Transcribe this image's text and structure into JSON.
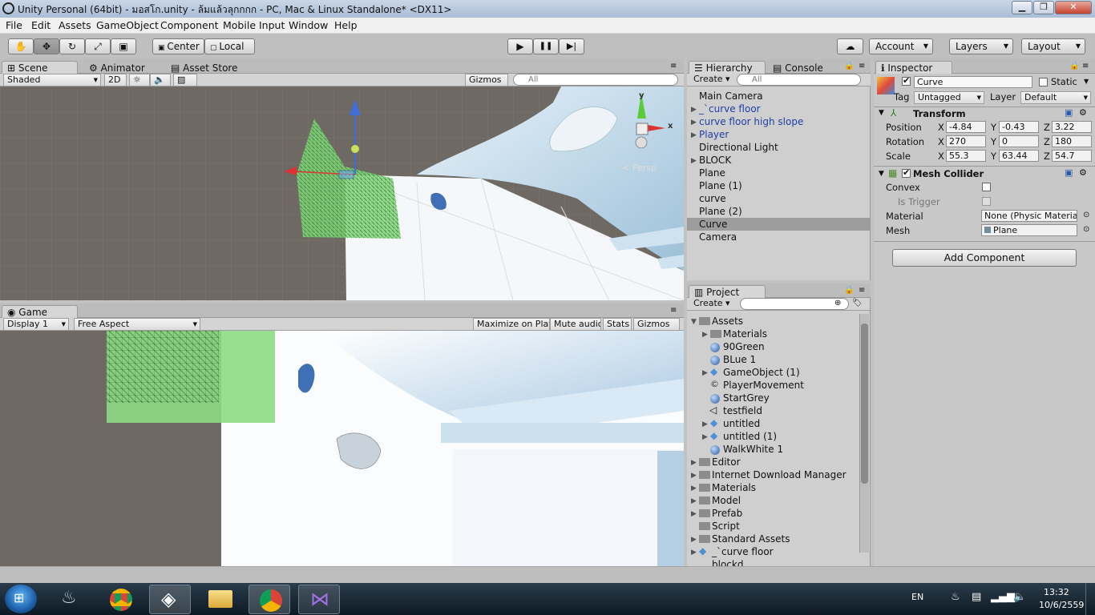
{
  "window": {
    "title": "Unity Personal (64bit) - มอสโก.unity - ล้มแล้วลุกกกก - PC, Mac & Linux Standalone* <DX11>",
    "min_label": "▁",
    "max_label": "❐",
    "close_label": "✕"
  },
  "menu": [
    "File",
    "Edit",
    "Assets",
    "GameObject",
    "Component",
    "Mobile Input",
    "Window",
    "Help"
  ],
  "toolbar": {
    "pivot": "Center",
    "space": "Local",
    "play": "▶",
    "pause": "❚❚",
    "step": "▶|",
    "account": "Account",
    "layers": "Layers",
    "layout": "Layout"
  },
  "scene": {
    "tabs": [
      "Scene",
      "Animator",
      "Asset Store"
    ],
    "shading": "Shaded",
    "mode2d": "2D",
    "gizmos": "Gizmos",
    "search_placeholder": "All",
    "persp": "< Persp"
  },
  "game": {
    "tab": "Game",
    "display": "Display 1",
    "aspect": "Free Aspect",
    "maximize": "Maximize on Play",
    "mute": "Mute audio",
    "stats": "Stats",
    "gizmos": "Gizmos"
  },
  "hierarchy": {
    "tabs": [
      "Hierarchy",
      "Console"
    ],
    "create": "Create",
    "search_placeholder": "All",
    "items": [
      {
        "label": "Main Camera",
        "expandable": false,
        "prefab": false
      },
      {
        "label": "_`curve floor",
        "expandable": true,
        "prefab": true
      },
      {
        "label": "curve floor high slope",
        "expandable": true,
        "prefab": true
      },
      {
        "label": "Player",
        "expandable": true,
        "prefab": true
      },
      {
        "label": "Directional Light",
        "expandable": false,
        "prefab": false
      },
      {
        "label": "BLOCK",
        "expandable": true,
        "prefab": false
      },
      {
        "label": "Plane",
        "expandable": false,
        "prefab": false
      },
      {
        "label": "Plane (1)",
        "expandable": false,
        "prefab": false
      },
      {
        "label": "curve",
        "expandable": false,
        "prefab": false
      },
      {
        "label": "Plane (2)",
        "expandable": false,
        "prefab": false
      },
      {
        "label": "Curve",
        "expandable": false,
        "prefab": false,
        "selected": true
      },
      {
        "label": "Camera",
        "expandable": false,
        "prefab": false
      }
    ]
  },
  "project": {
    "tab": "Project",
    "create": "Create",
    "items": [
      {
        "label": "Assets",
        "indent": 0,
        "kind": "folder",
        "open": true
      },
      {
        "label": "Materials",
        "indent": 1,
        "kind": "folder"
      },
      {
        "label": "90Green",
        "indent": 1,
        "kind": "material"
      },
      {
        "label": "BLue 1",
        "indent": 1,
        "kind": "material"
      },
      {
        "label": "GameObject (1)",
        "indent": 1,
        "kind": "prefab"
      },
      {
        "label": "PlayerMovement",
        "indent": 1,
        "kind": "script"
      },
      {
        "label": "StartGrey",
        "indent": 1,
        "kind": "material"
      },
      {
        "label": "testfield",
        "indent": 1,
        "kind": "scene"
      },
      {
        "label": "untitled",
        "indent": 1,
        "kind": "prefab"
      },
      {
        "label": "untitled (1)",
        "indent": 1,
        "kind": "prefab"
      },
      {
        "label": "WalkWhite 1",
        "indent": 1,
        "kind": "material"
      },
      {
        "label": "Editor",
        "indent": 0,
        "kind": "folder"
      },
      {
        "label": "Internet Download Manager",
        "indent": 0,
        "kind": "folder"
      },
      {
        "label": "Materials",
        "indent": 0,
        "kind": "folder"
      },
      {
        "label": "Model",
        "indent": 0,
        "kind": "folder"
      },
      {
        "label": "Prefab",
        "indent": 0,
        "kind": "folder"
      },
      {
        "label": "Script",
        "indent": 0,
        "kind": "folder"
      },
      {
        "label": "Standard Assets",
        "indent": 0,
        "kind": "folder"
      },
      {
        "label": "_`curve floor",
        "indent": 0,
        "kind": "prefab"
      },
      {
        "label": "blockd",
        "indent": 0,
        "kind": "prefab"
      }
    ]
  },
  "inspector": {
    "tab": "Inspector",
    "object_name": "Curve",
    "static_label": "Static",
    "tag_label": "Tag",
    "tag_value": "Untagged",
    "layer_label": "Layer",
    "layer_value": "Default",
    "transform": {
      "title": "Transform",
      "position_label": "Position",
      "rotation_label": "Rotation",
      "scale_label": "Scale",
      "position": {
        "x": "-4.84",
        "y": "-0.43",
        "z": "3.22"
      },
      "rotation": {
        "x": "270",
        "y": "0",
        "z": "180"
      },
      "scale": {
        "x": "55.3",
        "y": "63.44",
        "z": "54.7"
      }
    },
    "mesh_collider": {
      "title": "Mesh Collider",
      "convex_label": "Convex",
      "trigger_label": "Is Trigger",
      "material_label": "Material",
      "material_value": "None (Physic Material)",
      "mesh_label": "Mesh",
      "mesh_value": "Plane"
    },
    "add_component": "Add Component"
  },
  "taskbar": {
    "lang": "EN",
    "time": "13:32",
    "date": "10/6/2559"
  },
  "colors": {
    "selection": "#9d9d9d",
    "prefab_text": "#1f3fa8",
    "wire_green": "#7fd77a",
    "sky_white": "#eef5fb"
  }
}
